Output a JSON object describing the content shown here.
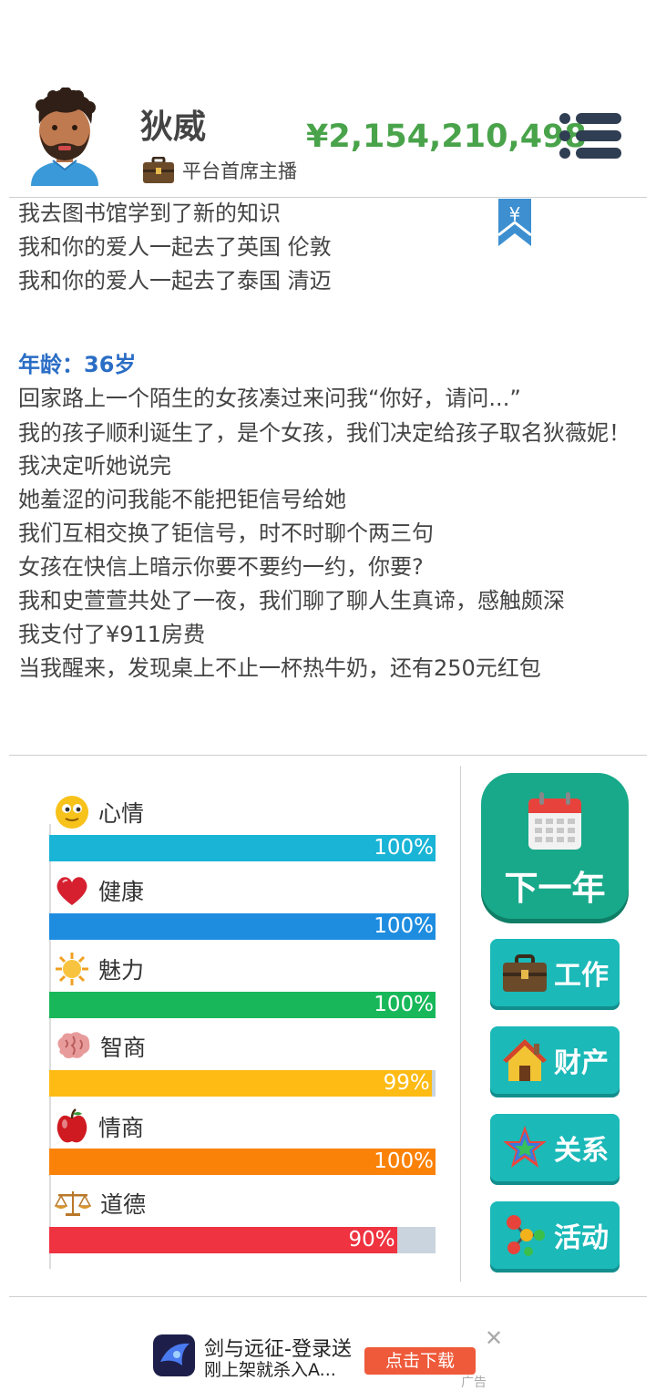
{
  "profile": {
    "name": "狄威",
    "title": "平台首席主播",
    "money": "¥2,154,210,498"
  },
  "log": {
    "lines_top": [
      "我去图书馆学到了新的知识",
      "我和你的爱人一起去了英国 伦敦",
      "我和你的爱人一起去了泰国 清迈"
    ],
    "age_label": "年龄：36岁",
    "lines_bottom": [
      "回家路上一个陌生的女孩凑过来问我“你好，请问...”",
      "我的孩子顺利诞生了，是个女孩，我们决定给孩子取名狄薇妮！",
      "我决定听她说完",
      "她羞涩的问我能不能把钜信号给她",
      "我们互相交换了钜信号，时不时聊个两三句",
      "女孩在快信上暗示你要不要约一约，你要?",
      "我和史萱萱共处了一夜，我们聊了聊人生真谛，感触颇深",
      "我支付了¥911房费",
      "当我醒来，发现桌上不止一杯热牛奶，还有250元红包"
    ],
    "bookmark_symbol": "¥"
  },
  "stats": [
    {
      "name": "心情",
      "value_label": "100%",
      "fraction": 1.0,
      "color": "#19b4d6",
      "icon": "smiley-icon"
    },
    {
      "name": "健康",
      "value_label": "100%",
      "fraction": 1.0,
      "color": "#1e8de0",
      "icon": "heart-icon"
    },
    {
      "name": "魅力",
      "value_label": "100%",
      "fraction": 1.0,
      "color": "#18b85a",
      "icon": "sun-icon"
    },
    {
      "name": "智商",
      "value_label": "99%",
      "fraction": 0.99,
      "color": "#fdbb14",
      "icon": "brain-icon"
    },
    {
      "name": "情商",
      "value_label": "100%",
      "fraction": 1.0,
      "color": "#fa8209",
      "icon": "apple-icon"
    },
    {
      "name": "道德",
      "value_label": "90%",
      "fraction": 0.9,
      "color": "#ef3340",
      "icon": "scales-icon"
    }
  ],
  "buttons": {
    "next_year": "下一年",
    "work": "工作",
    "property": "财产",
    "relations": "关系",
    "activities": "活动"
  },
  "ad": {
    "title": "剑与远征-登录送",
    "subtitle": "刚上架就杀入A...",
    "button": "点击下载",
    "tag": "广告",
    "close": "✕"
  }
}
